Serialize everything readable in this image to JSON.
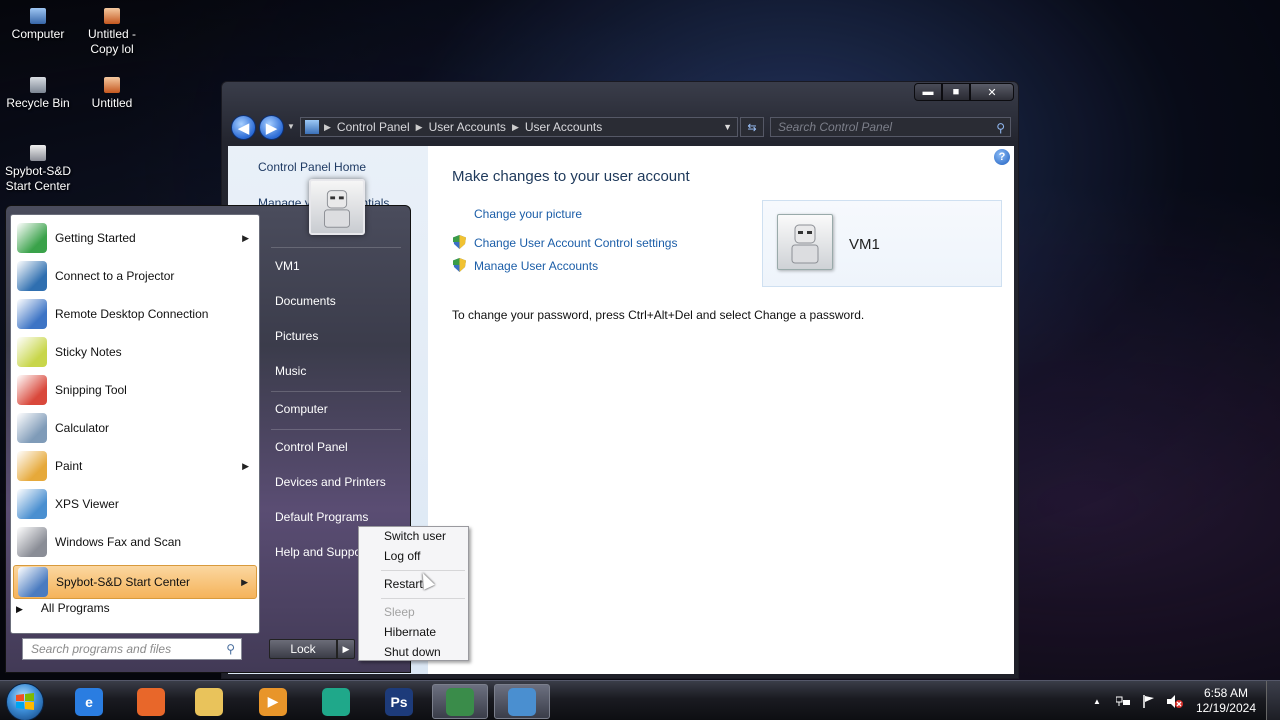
{
  "desktop": {
    "icons": [
      {
        "label": "Computer"
      },
      {
        "label": "Untitled - Copy lol"
      },
      {
        "label": "Recycle Bin"
      },
      {
        "label": "Untitled"
      },
      {
        "label": "Spybot-S&D Start Center"
      }
    ]
  },
  "window": {
    "controls": {
      "minimize": "▬",
      "maximize": "■",
      "close": "✕"
    },
    "nav": {
      "back": "◀",
      "forward": "▶"
    },
    "breadcrumb": [
      "Control Panel",
      "User Accounts",
      "User Accounts"
    ],
    "search_placeholder": "Search Control Panel",
    "left_pane": {
      "home": "Control Panel Home",
      "manage": "Manage your credentials"
    },
    "main": {
      "title": "Make changes to your user account",
      "change_picture": "Change your picture",
      "uac_settings": "Change User Account Control settings",
      "manage_accounts": "Manage User Accounts",
      "password_text": "To change your password, press Ctrl+Alt+Del and select Change a password."
    },
    "user_card": {
      "name": "VM1"
    },
    "help": "?"
  },
  "start_menu": {
    "programs": [
      {
        "label": "Getting Started",
        "submenu": true,
        "icon": "getting-started-icon",
        "color": "#3aa24a"
      },
      {
        "label": "Connect to a Projector",
        "submenu": false,
        "icon": "projector-icon",
        "color": "#2f6fb0"
      },
      {
        "label": "Remote Desktop Connection",
        "submenu": false,
        "icon": "remote-desktop-icon",
        "color": "#3d74c5"
      },
      {
        "label": "Sticky Notes",
        "submenu": false,
        "icon": "sticky-notes-icon",
        "color": "#c8d64a"
      },
      {
        "label": "Snipping Tool",
        "submenu": false,
        "icon": "scissors-icon",
        "color": "#d9483b"
      },
      {
        "label": "Calculator",
        "submenu": false,
        "icon": "calculator-icon",
        "color": "#7f9bb8"
      },
      {
        "label": "Paint",
        "submenu": true,
        "icon": "paint-icon",
        "color": "#e6a93a"
      },
      {
        "label": "XPS Viewer",
        "submenu": false,
        "icon": "xps-viewer-icon",
        "color": "#4a8fd0"
      },
      {
        "label": "Windows Fax and Scan",
        "submenu": false,
        "icon": "fax-icon",
        "color": "#8a8d96"
      },
      {
        "label": "Spybot-S&D Start Center",
        "submenu": true,
        "icon": "spybot-icon",
        "color": "#4a7bc0",
        "highlighted": true
      }
    ],
    "all_programs": "All Programs",
    "search_placeholder": "Search programs and files",
    "right_items": [
      "VM1",
      "Documents",
      "Pictures",
      "Music",
      "Computer",
      "Control Panel",
      "Devices and Printers",
      "Default Programs",
      "Help and Support"
    ],
    "lock_label": "Lock",
    "lock_arrow": "▶"
  },
  "power_menu": {
    "items": [
      {
        "label": "Switch user",
        "enabled": true
      },
      {
        "label": "Log off",
        "enabled": true
      },
      {
        "label": "Restart",
        "enabled": true
      },
      {
        "label": "Sleep",
        "enabled": false
      },
      {
        "label": "Hibernate",
        "enabled": true
      },
      {
        "label": "Shut down",
        "enabled": true
      }
    ]
  },
  "taskbar": {
    "pinned": [
      {
        "name": "internet-explorer-icon",
        "glyph": "e",
        "color": "#2a7de1"
      },
      {
        "name": "firefox-icon",
        "glyph": "",
        "color": "#e8672a"
      },
      {
        "name": "file-explorer-icon",
        "glyph": "",
        "color": "#e9c35b"
      },
      {
        "name": "media-player-icon",
        "glyph": "▶",
        "color": "#e8952a"
      },
      {
        "name": "edge-icon",
        "glyph": "",
        "color": "#1fa88a"
      },
      {
        "name": "photoshop-icon",
        "glyph": "Ps",
        "color": "#1d3b7a"
      },
      {
        "name": "task-manager-icon",
        "glyph": "",
        "color": "#3a8c4a"
      },
      {
        "name": "control-panel-icon",
        "glyph": "",
        "color": "#4a8fd0"
      }
    ],
    "tray": {
      "chevron": "▲",
      "time": "6:58 AM",
      "date": "12/19/2024"
    }
  }
}
